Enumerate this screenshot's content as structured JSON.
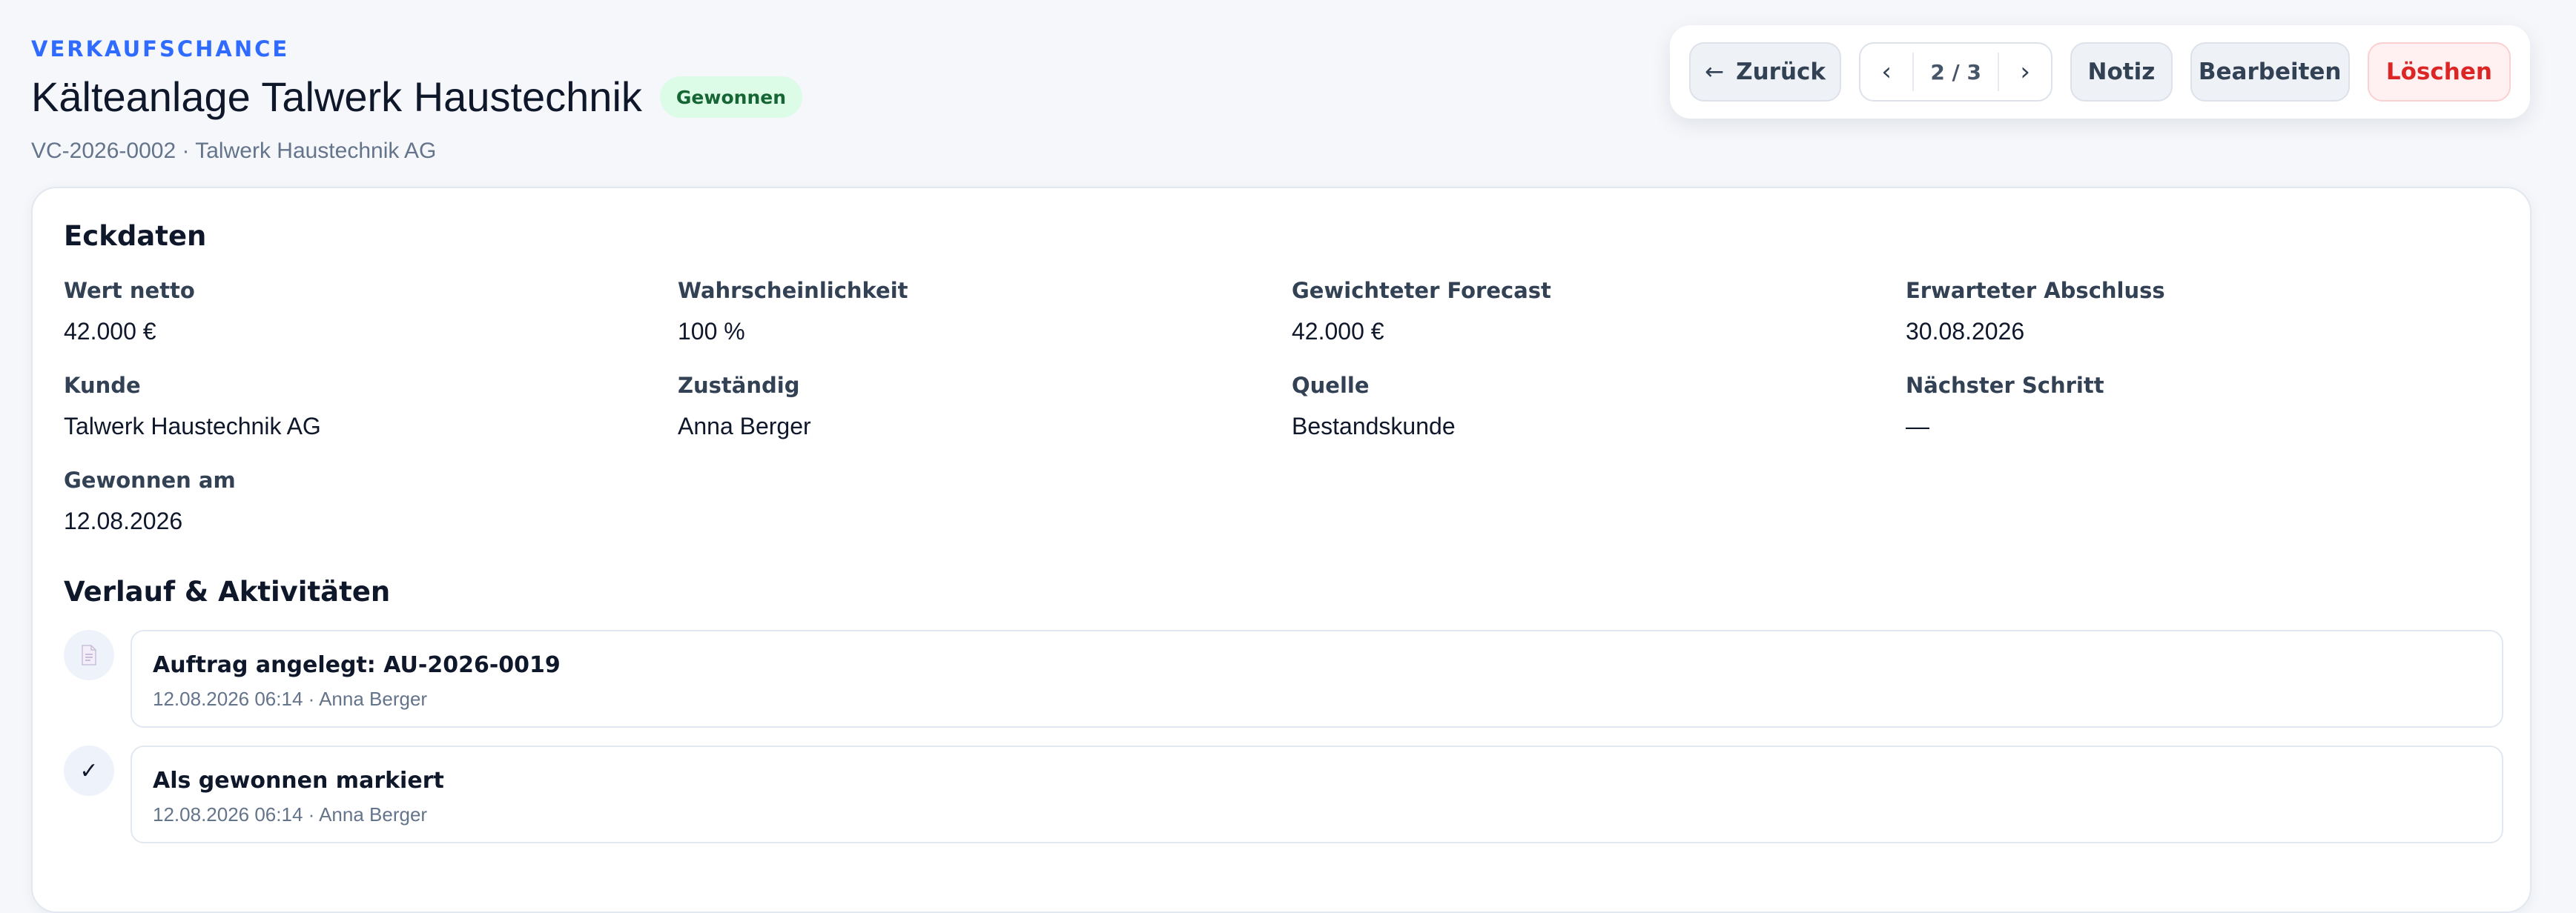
{
  "header": {
    "kicker": "VERKAUFSCHANCE",
    "title": "Kälteanlage Talwerk Haustechnik",
    "status_badge": "Gewonnen",
    "subtitle": "VC-2026-0002 · Talwerk Haustechnik AG"
  },
  "toolbar": {
    "back_arrow": "←",
    "back_label": "Zurück",
    "pager_prev": "‹",
    "pager_count": "2 / 3",
    "pager_next": "›",
    "note_label": "Notiz",
    "edit_label": "Bearbeiten",
    "delete_label": "Löschen"
  },
  "key_facts": {
    "title": "Eckdaten",
    "fields": [
      {
        "label": "Wert netto",
        "value": "42.000 €"
      },
      {
        "label": "Wahrscheinlichkeit",
        "value": "100 %"
      },
      {
        "label": "Gewichteter Forecast",
        "value": "42.000 €"
      },
      {
        "label": "Erwarteter Abschluss",
        "value": "30.08.2026"
      },
      {
        "label": "Kunde",
        "value": "Talwerk Haustechnik AG"
      },
      {
        "label": "Zuständig",
        "value": "Anna Berger"
      },
      {
        "label": "Quelle",
        "value": "Bestandskunde"
      },
      {
        "label": "Nächster Schritt",
        "value": "—"
      },
      {
        "label": "Gewonnen am",
        "value": "12.08.2026"
      }
    ]
  },
  "activity": {
    "title": "Verlauf & Aktivitäten",
    "items": [
      {
        "icon": "document-icon",
        "title": "Auftrag angelegt: AU-2026-0019",
        "meta": "12.08.2026 06:14 · Anna Berger"
      },
      {
        "icon": "checkmark-icon",
        "glyph": "✓",
        "title": "Als gewonnen markiert",
        "meta": "12.08.2026 06:14 · Anna Berger"
      }
    ]
  },
  "colors": {
    "accent": "#2f6bff",
    "success_bg": "#dcfce7",
    "success_text": "#166534",
    "danger": "#dc2626"
  }
}
